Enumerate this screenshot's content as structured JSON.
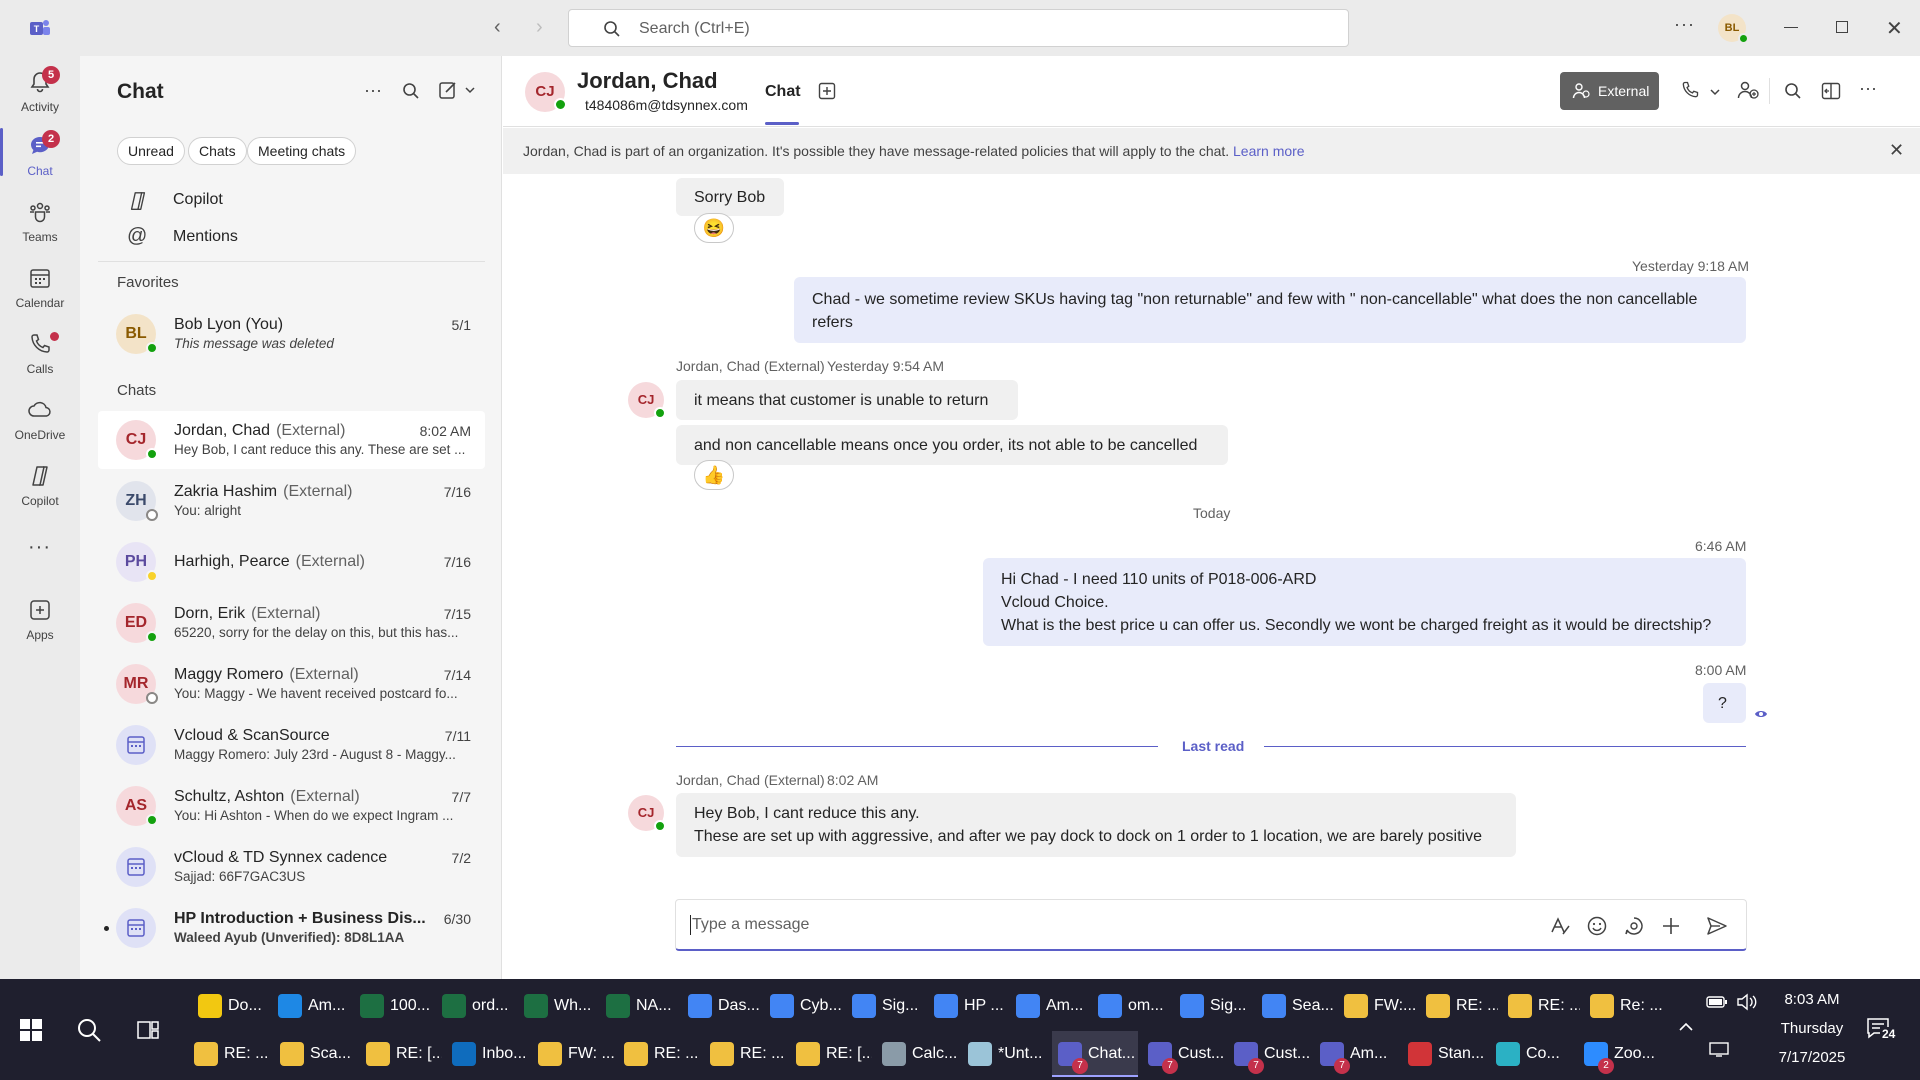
{
  "titlebar": {
    "search_placeholder": "Search (Ctrl+E)",
    "user_initials": "BL"
  },
  "rail": [
    {
      "label": "Activity",
      "badge": "5"
    },
    {
      "label": "Chat",
      "badge": "2"
    },
    {
      "label": "Teams",
      "badge": ""
    },
    {
      "label": "Calendar",
      "badge": ""
    },
    {
      "label": "Calls",
      "badge": ""
    },
    {
      "label": "OneDrive",
      "badge": ""
    },
    {
      "label": "Copilot",
      "badge": ""
    },
    {
      "label": "Apps",
      "badge": ""
    }
  ],
  "chatlist": {
    "title": "Chat",
    "filters": [
      "Unread",
      "Chats",
      "Meeting chats"
    ],
    "copilot": "Copilot",
    "mentions": "Mentions",
    "favorites_header": "Favorites",
    "chats_header": "Chats",
    "favorites": [
      {
        "initials": "BL",
        "name": "Bob Lyon (You)",
        "ext": "",
        "date": "5/1",
        "preview": "This message was deleted"
      }
    ],
    "chats": [
      {
        "initials": "CJ",
        "name": "Jordan, Chad",
        "ext": "(External)",
        "date": "8:02 AM",
        "preview": "Hey Bob, I cant reduce this any. These are set ..."
      },
      {
        "initials": "ZH",
        "name": "Zakria Hashim",
        "ext": "(External)",
        "date": "7/16",
        "preview": "You: alright"
      },
      {
        "initials": "PH",
        "name": "Harhigh, Pearce",
        "ext": "(External)",
        "date": "7/16",
        "preview": ""
      },
      {
        "initials": "ED",
        "name": "Dorn, Erik",
        "ext": "(External)",
        "date": "7/15",
        "preview": "65220, sorry for the delay on this, but this has..."
      },
      {
        "initials": "MR",
        "name": "Maggy Romero",
        "ext": "(External)",
        "date": "7/14",
        "preview": "You: Maggy - We havent received postcard fo..."
      },
      {
        "initials": "",
        "name": "Vcloud & ScanSource",
        "ext": "",
        "date": "7/11",
        "preview": "Maggy Romero: July 23rd - August 8 - Maggy..."
      },
      {
        "initials": "AS",
        "name": "Schultz, Ashton",
        "ext": "(External)",
        "date": "7/7",
        "preview": "You: Hi Ashton -  When do we expect Ingram ..."
      },
      {
        "initials": "",
        "name": "vCloud & TD Synnex cadence",
        "ext": "",
        "date": "7/2",
        "preview": "Sajjad: 66F7GAC3US"
      },
      {
        "initials": "",
        "name": "HP Introduction + Business Dis...",
        "ext": "",
        "date": "6/30",
        "preview": "Waleed Ayub (Unverified): 8D8L1AA"
      }
    ]
  },
  "conversation": {
    "contact_initials": "CJ",
    "contact_name": "Jordan, Chad",
    "contact_email": "t484086m@tdsynnex.com",
    "tab_chat": "Chat",
    "external_label": "External",
    "banner_text": "Jordan, Chad is part of an organization. It's possible they have message-related policies that will apply to the chat.",
    "banner_link": "Learn more",
    "msg_sorry": "Sorry Bob",
    "meta_1": "Yesterday 9:18 AM",
    "msg_mine_1": "Chad -  we sometime review SKUs having tag \"non returnable\" and few with \" non-cancellable\" what does the non cancellable refers",
    "meta_2_name": "Jordan, Chad (External)",
    "meta_2_time": "Yesterday 9:54 AM",
    "msg_theirs_1": "it means that customer is unable to return",
    "msg_theirs_2": "and non cancellable means once you order, its not able to be cancelled",
    "day_divider": "Today",
    "meta_3": "6:46 AM",
    "msg_mine_2_l1": "Hi Chad -  I need 110 units of P018-006-ARD",
    "msg_mine_2_l2": "Vcloud Choice.",
    "msg_mine_2_l3": "What is the best price u can offer us. Secondly we wont be charged freight as it would be directship?",
    "meta_4": "8:00 AM",
    "msg_mine_3": "?",
    "last_read": "Last read",
    "meta_5_name": "Jordan, Chad (External)",
    "meta_5_time": "8:02 AM",
    "msg_theirs_3_l1": "Hey Bob, I cant reduce this any.",
    "msg_theirs_3_l2": "These are set up with aggressive, and after we pay dock to dock on 1 order to 1 location, we are barely positive",
    "composer_placeholder": "Type a message"
  },
  "taskbar": {
    "row1": [
      "Do...",
      "Am...",
      "100...",
      "ord...",
      "Wh...",
      "NA...",
      "Das...",
      "Cyb...",
      "Sig...",
      "HP ...",
      "Am...",
      "om...",
      "Sig...",
      "Sea...",
      "FW:...",
      "RE: ...",
      "RE: ...",
      "Re: ..."
    ],
    "row2": [
      "RE: ...",
      "Sca...",
      "RE: [...",
      "Inbo...",
      "FW: ...",
      "RE: ...",
      "RE: ...",
      "RE: [...",
      "Calc...",
      "*Unt...",
      "Chat...",
      "Cust...",
      "Cust...",
      "Am...",
      "Stan...",
      "Co...",
      "Zoo..."
    ],
    "time": "8:03 AM",
    "day": "Thursday",
    "date": "7/17/2025",
    "notif_count": "24"
  },
  "colors": {
    "accent": "#5b5fc7",
    "badge": "#c4314b",
    "presence_available": "#13a10e"
  }
}
